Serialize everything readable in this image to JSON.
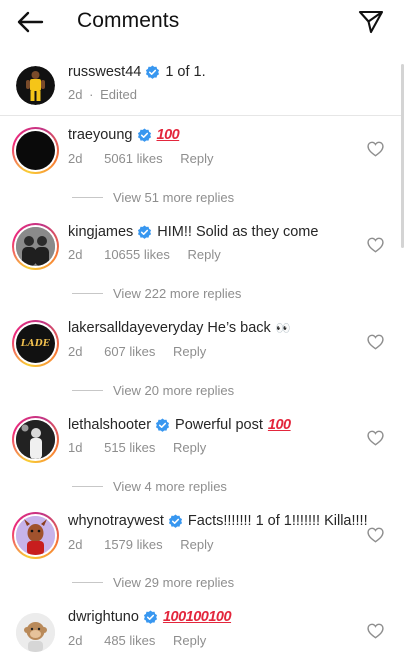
{
  "header": {
    "title": "Comments",
    "back_icon": "arrow-left-icon",
    "share_icon": "paper-plane-icon"
  },
  "caption": {
    "username": "russwest44",
    "text": "1 of 1.",
    "time": "2d",
    "edited": "Edited",
    "meta_sep": "·"
  },
  "comments": [
    {
      "username": "traeyoung",
      "verified": true,
      "text": "",
      "emoji": "💯",
      "time": "2d",
      "likes": "5061 likes",
      "reply": "Reply",
      "more_replies": "View 51 more replies"
    },
    {
      "username": "kingjames",
      "verified": true,
      "text": "HIM!! Solid as they come",
      "emoji": "",
      "time": "2d",
      "likes": "10655 likes",
      "reply": "Reply",
      "more_replies": "View 222 more replies"
    },
    {
      "username": "lakersalldayeveryday",
      "verified": false,
      "text": "He’s back",
      "emoji": "👀",
      "time": "2d",
      "likes": "607 likes",
      "reply": "Reply",
      "more_replies": "View 20 more replies"
    },
    {
      "username": "lethalshooter",
      "verified": true,
      "text": "Powerful post",
      "emoji": "💯",
      "time": "1d",
      "likes": "515 likes",
      "reply": "Reply",
      "more_replies": "View 4 more replies"
    },
    {
      "username": "whynotraywest",
      "verified": true,
      "text": "Facts!!!!!!! 1 of 1!!!!!!! Killa!!!!",
      "emoji": "",
      "time": "2d",
      "likes": "1579 likes",
      "reply": "Reply",
      "more_replies": "View 29 more replies"
    },
    {
      "username": "dwrightuno",
      "verified": true,
      "text": "",
      "emoji": "💯💯💯",
      "time": "2d",
      "likes": "485 likes",
      "reply": "Reply",
      "more_replies": ""
    }
  ],
  "avatar_labels": {
    "lakers": "LADE"
  },
  "colors": {
    "verified": "#3897f0",
    "hundred": "#e3263c",
    "muted": "#8e8e8e"
  }
}
